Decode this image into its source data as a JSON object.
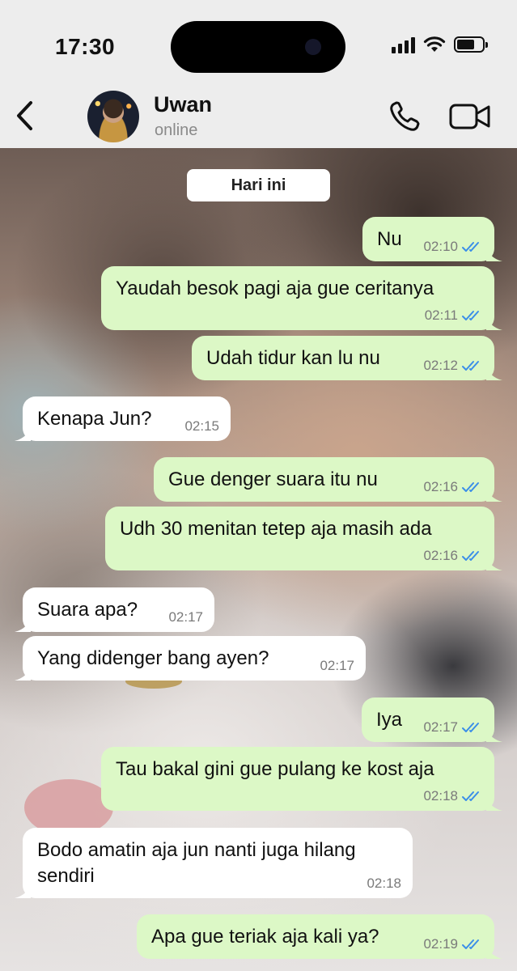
{
  "status_bar": {
    "time": "17:30"
  },
  "header": {
    "contact_name": "Uwan",
    "contact_status": "online",
    "icons": [
      "chevron-left-icon",
      "phone-icon",
      "video-camera-icon"
    ]
  },
  "chat": {
    "date_label": "Hari ini",
    "messages": [
      {
        "dir": "out",
        "text": "Nu",
        "time": "02:10"
      },
      {
        "dir": "out",
        "text": "Yaudah besok pagi aja gue ceritanya",
        "time": "02:11"
      },
      {
        "dir": "out",
        "text": "Udah tidur kan lu nu",
        "time": "02:12"
      },
      {
        "dir": "in",
        "text": "Kenapa Jun?",
        "time": "02:15"
      },
      {
        "dir": "out",
        "text": "Gue denger suara itu nu",
        "time": "02:16"
      },
      {
        "dir": "out",
        "text": "Udh 30 menitan tetep aja masih ada",
        "time": "02:16"
      },
      {
        "dir": "in",
        "text": "Suara apa?",
        "time": "02:17"
      },
      {
        "dir": "in",
        "text": "Yang didenger bang ayen?",
        "time": "02:17"
      },
      {
        "dir": "out",
        "text": "Iya",
        "time": "02:17"
      },
      {
        "dir": "out",
        "text": "Tau bakal gini gue pulang ke kost aja",
        "time": "02:18"
      },
      {
        "dir": "in",
        "text": "Bodo amatin aja jun nanti juga hilang\nsendiri",
        "time": "02:18"
      },
      {
        "dir": "out",
        "text": "Apa gue teriak aja kali ya?",
        "time": "02:19"
      }
    ]
  },
  "colors": {
    "outgoing_bubble": "#dcf8c6",
    "incoming_bubble": "#ffffff",
    "read_ticks": "#3b8ee8",
    "header_bg": "#ededed"
  }
}
